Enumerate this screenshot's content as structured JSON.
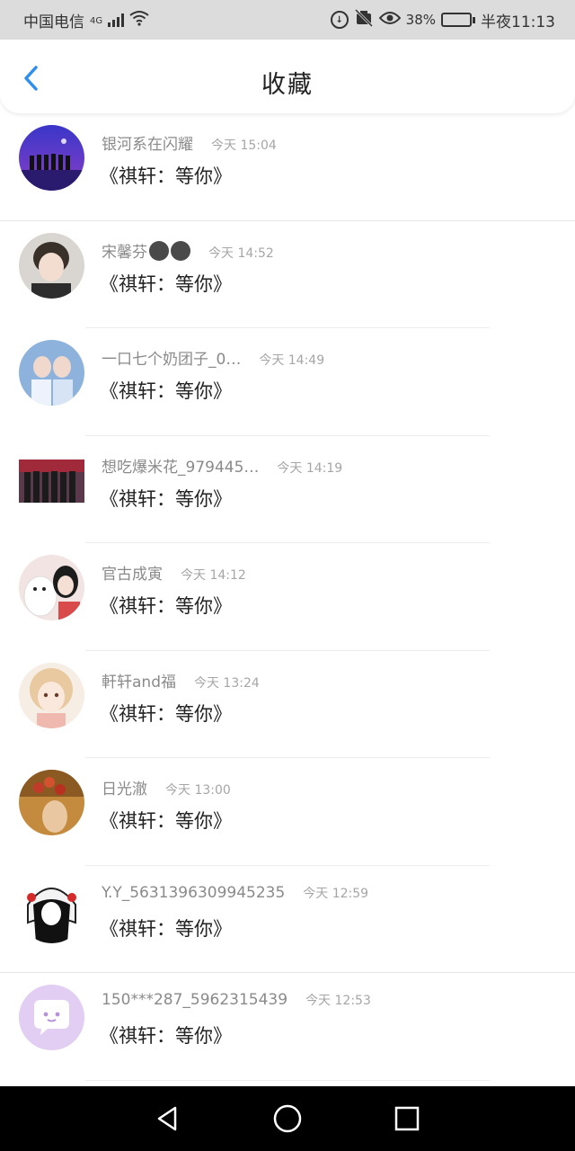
{
  "status_bar": {
    "carrier": "中国电信",
    "network": "4G",
    "battery": "38%",
    "battery_level": 0.38,
    "time": "半夜11:13"
  },
  "header": {
    "title": "收藏"
  },
  "items": [
    {
      "name": "银河系在闪耀",
      "time": "今天 15:04",
      "message": "《祺轩：等你》"
    },
    {
      "name": "宋馨芬",
      "time": "今天 14:52",
      "message": "《祺轩：等你》"
    },
    {
      "name": "一口七个奶团子_0…",
      "time": "今天 14:49",
      "message": "《祺轩：等你》"
    },
    {
      "name": "想吃爆米花_979445…",
      "time": "今天 14:19",
      "message": "《祺轩：等你》"
    },
    {
      "name": "官古成寅",
      "time": "今天 14:12",
      "message": "《祺轩：等你》"
    },
    {
      "name": "軒轩and福",
      "time": "今天 13:24",
      "message": "《祺轩：等你》"
    },
    {
      "name": "日光澈",
      "time": "今天 13:00",
      "message": "《祺轩：等你》"
    },
    {
      "name": "Y.Y_5631396309945235",
      "time": "今天 12:59",
      "message": "《祺轩：等你》"
    },
    {
      "name": "150***287_5962315439",
      "time": "今天 12:53",
      "message": "《祺轩：等你》"
    }
  ],
  "colors": {
    "accent": "#2f8ff0",
    "status_bar_bg": "#dcdcdc",
    "nav_bar_bg": "#000000"
  },
  "icons": {
    "back": "chevron-left-icon",
    "nav_back": "triangle-back-icon",
    "nav_home": "circle-home-icon",
    "nav_recent": "square-recent-icon"
  }
}
